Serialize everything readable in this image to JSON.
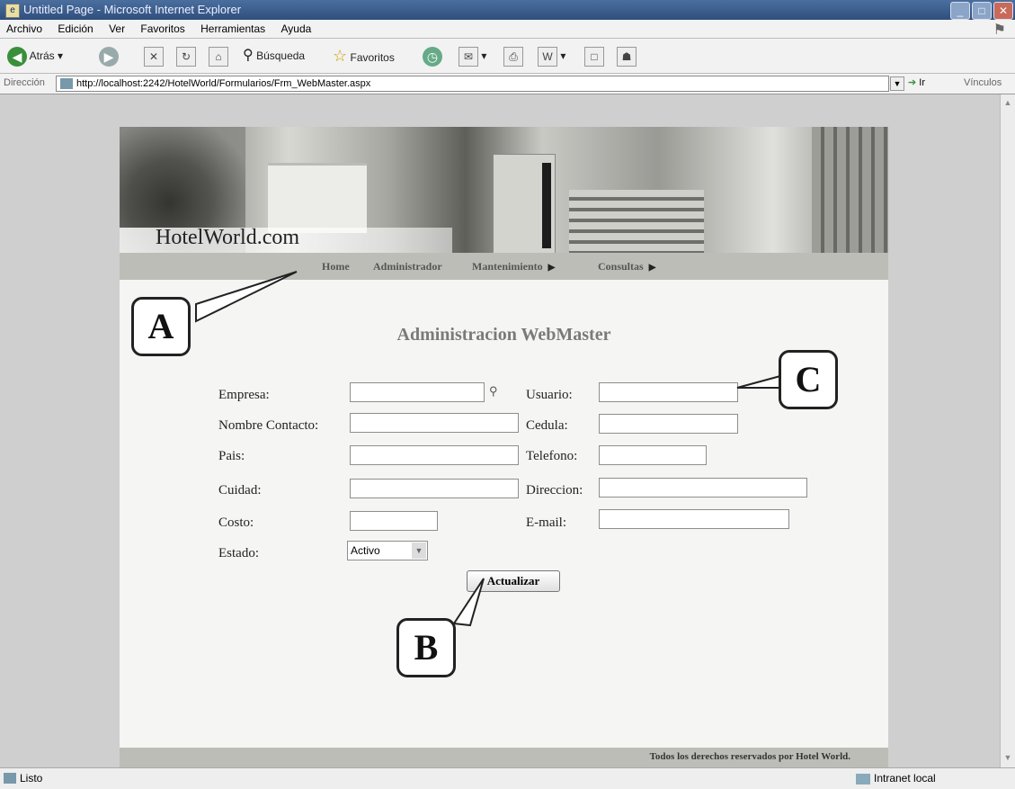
{
  "window": {
    "title": "Untitled Page - Microsoft Internet Explorer"
  },
  "menu": {
    "items": [
      "Archivo",
      "Edición",
      "Ver",
      "Favoritos",
      "Herramientas",
      "Ayuda"
    ]
  },
  "toolbar": {
    "back_label": "Atrás",
    "search_label": "Búsqueda",
    "favorites_label": "Favoritos"
  },
  "address": {
    "label": "Dirección",
    "url": "http://localhost:2242/HotelWorld/Formularios/Frm_WebMaster.aspx",
    "go_label": "Ir",
    "links_label": "Vínculos"
  },
  "site": {
    "logo": "HotelWorld.com",
    "nav": [
      "Home",
      "Administrador",
      "Mantenimiento",
      "Consultas"
    ],
    "page_title": "Administracion WebMaster",
    "footer": "Todos los derechos reservados por Hotel World."
  },
  "form": {
    "empresa": {
      "label": "Empresa:",
      "value": ""
    },
    "nombre_contacto": {
      "label": "Nombre Contacto:",
      "value": ""
    },
    "pais": {
      "label": "Pais:",
      "value": ""
    },
    "cuidad": {
      "label": "Cuidad:",
      "value": ""
    },
    "costo": {
      "label": "Costo:",
      "value": ""
    },
    "estado": {
      "label": "Estado:",
      "value": "Activo"
    },
    "usuario": {
      "label": "Usuario:",
      "value": ""
    },
    "cedula": {
      "label": "Cedula:",
      "value": ""
    },
    "telefono": {
      "label": "Telefono:",
      "value": ""
    },
    "direccion": {
      "label": "Direccion:",
      "value": ""
    },
    "email": {
      "label": "E-mail:",
      "value": ""
    },
    "submit_label": "Actualizar"
  },
  "callouts": {
    "a": "A",
    "b": "B",
    "c": "C"
  },
  "status": {
    "text": "Listo",
    "zone": "Intranet local"
  }
}
